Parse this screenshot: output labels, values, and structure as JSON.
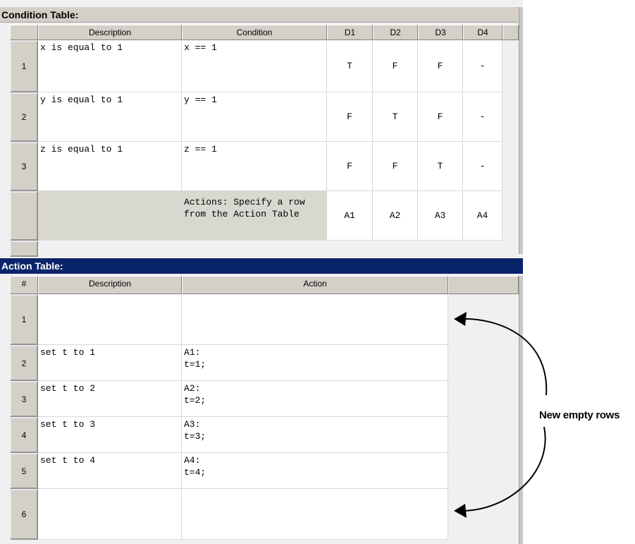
{
  "condition_table": {
    "title": "Condition Table:",
    "headers": {
      "description": "Description",
      "condition": "Condition",
      "decisions": [
        "D1",
        "D2",
        "D3",
        "D4"
      ]
    },
    "rows": [
      {
        "num": "1",
        "description": "x is equal to 1",
        "condition": "x == 1",
        "decisions": [
          "T",
          "F",
          "F",
          "-"
        ]
      },
      {
        "num": "2",
        "description": "y is equal to 1",
        "condition": "y == 1",
        "decisions": [
          "F",
          "T",
          "F",
          "-"
        ]
      },
      {
        "num": "3",
        "description": "z is equal to 1",
        "condition": "z == 1",
        "decisions": [
          "F",
          "F",
          "T",
          "-"
        ]
      }
    ],
    "actions_row": {
      "label": "Actions: Specify a row\nfrom the Action Table",
      "values": [
        "A1",
        "A2",
        "A3",
        "A4"
      ]
    }
  },
  "action_table": {
    "title": "Action Table:",
    "headers": {
      "num": "#",
      "description": "Description",
      "action": "Action"
    },
    "rows": [
      {
        "num": "1",
        "description": "",
        "action": ""
      },
      {
        "num": "2",
        "description": "set t to 1",
        "action": "A1:\nt=1;"
      },
      {
        "num": "3",
        "description": "set t to 2",
        "action": "A2:\nt=2;"
      },
      {
        "num": "4",
        "description": "set t to 3",
        "action": "A3:\nt=3;"
      },
      {
        "num": "5",
        "description": "set t to 4",
        "action": "A4:\nt=4;"
      },
      {
        "num": "6",
        "description": "",
        "action": ""
      }
    ]
  },
  "annotation": {
    "text": "New empty rows"
  }
}
